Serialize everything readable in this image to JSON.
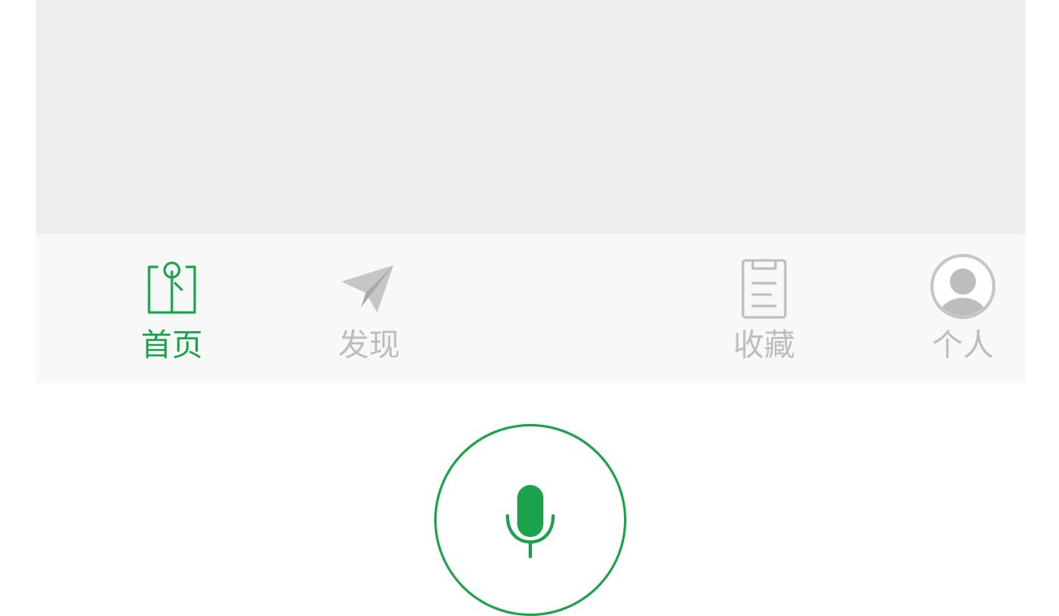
{
  "tabbar": {
    "items": [
      {
        "label": "首页",
        "icon": "home-book-icon",
        "active": true
      },
      {
        "label": "发现",
        "icon": "paper-plane-icon",
        "active": false
      },
      {
        "label": "收藏",
        "icon": "clipboard-icon",
        "active": false
      },
      {
        "label": "个人",
        "icon": "user-avatar-icon",
        "active": false
      }
    ],
    "voice_icon": "microphone-icon"
  },
  "colors": {
    "accent": "#1aa34a",
    "inactive": "#bdbdbd",
    "background": "#eeeeee",
    "tabbar_background": "#f8f8f8"
  }
}
